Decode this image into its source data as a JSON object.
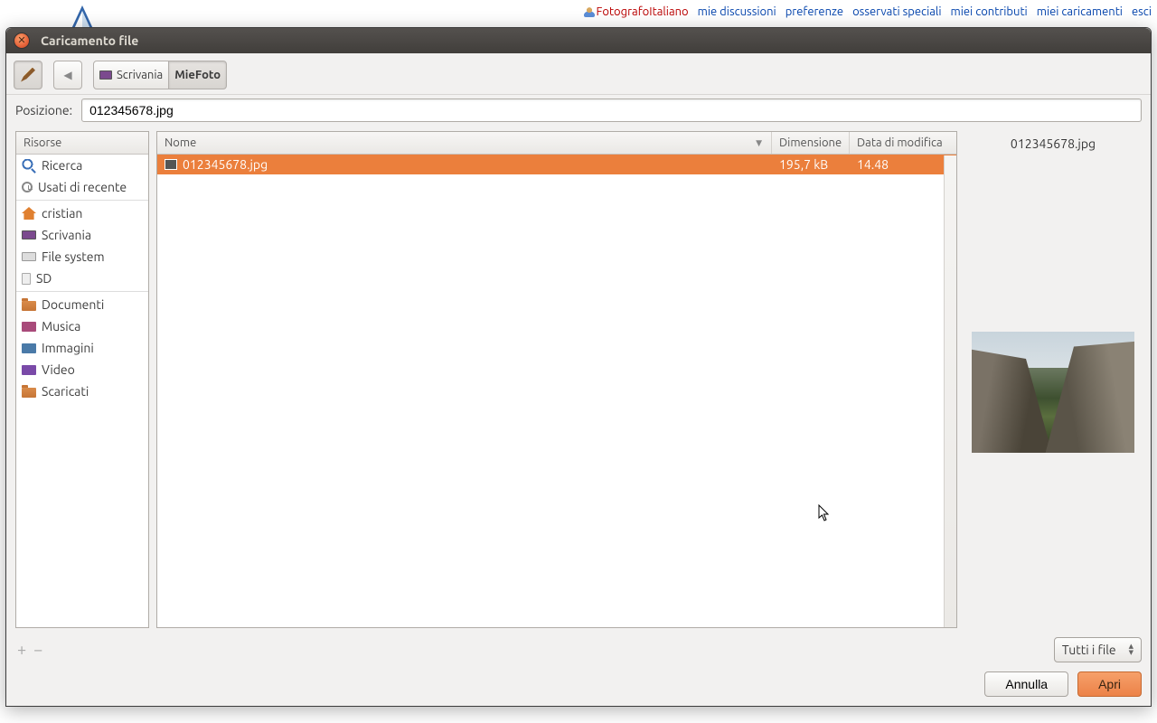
{
  "browser": {
    "toplinks": {
      "user": "FotografoItaliano",
      "talk": "mie discussioni",
      "prefs": "preferenze",
      "watch": "osservati speciali",
      "contrib": "miei contributi",
      "uploads": "miei caricamenti",
      "logout": "esci"
    }
  },
  "dialog": {
    "title": "Caricamento file",
    "breadcrumb": {
      "parent": "Scrivania",
      "current": "MieFoto"
    },
    "location": {
      "label": "Posizione:",
      "value": "012345678.jpg"
    },
    "sidebar": {
      "header": "Risorse",
      "groups": [
        [
          {
            "icon": "search",
            "label": "Ricerca"
          },
          {
            "icon": "recent",
            "label": "Usati di recente"
          }
        ],
        [
          {
            "icon": "home",
            "label": "cristian"
          },
          {
            "icon": "desk",
            "label": "Scrivania"
          },
          {
            "icon": "drive",
            "label": "File system"
          },
          {
            "icon": "sd",
            "label": "SD"
          }
        ],
        [
          {
            "icon": "folder",
            "label": "Documenti"
          },
          {
            "icon": "music",
            "label": "Musica"
          },
          {
            "icon": "img",
            "label": "Immagini"
          },
          {
            "icon": "video",
            "label": "Video"
          },
          {
            "icon": "folder",
            "label": "Scaricati"
          }
        ]
      ]
    },
    "file_columns": {
      "name": "Nome",
      "size": "Dimensione",
      "date": "Data di modifica"
    },
    "files": [
      {
        "name": "012345678.jpg",
        "size": "195,7 kB",
        "date": "14.48",
        "selected": true
      }
    ],
    "preview": {
      "name": "012345678.jpg"
    },
    "filter": "Tutti i file",
    "buttons": {
      "cancel": "Annulla",
      "open": "Apri"
    }
  }
}
